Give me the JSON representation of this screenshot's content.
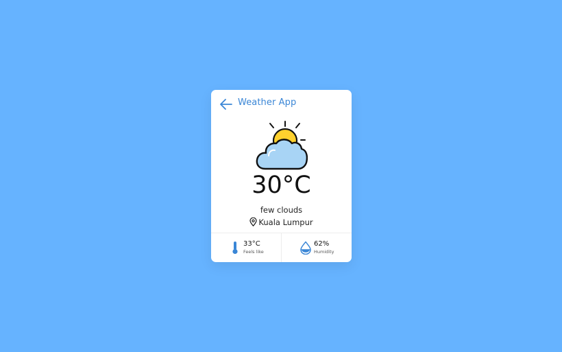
{
  "app": {
    "title": "Weather App"
  },
  "weather": {
    "icon": "sun-behind-cloud-icon",
    "temperature": "30°C",
    "description": "few clouds",
    "location": "Kuala Lumpur"
  },
  "stats": {
    "feels_like": {
      "value": "33°C",
      "label": "Feels like",
      "icon": "thermometer-icon"
    },
    "humidity": {
      "value": "62%",
      "label": "Humidity",
      "icon": "water-drop-icon"
    }
  },
  "colors": {
    "background": "#66b3ff",
    "accent": "#3a86d6",
    "sun": "#ffd12e",
    "cloud": "#a8d4f5"
  }
}
